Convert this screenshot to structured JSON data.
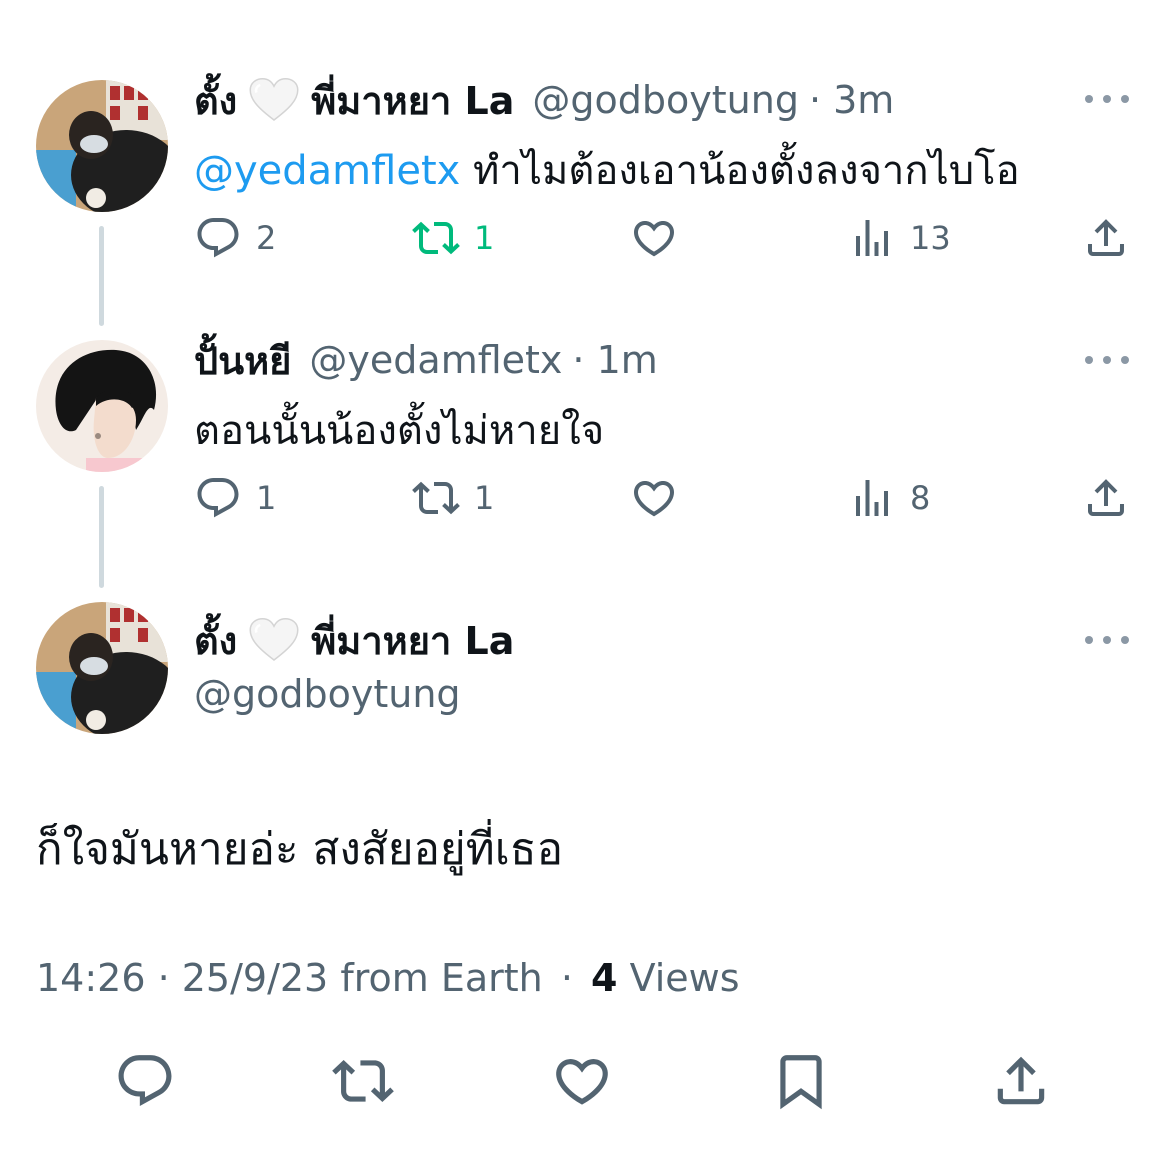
{
  "tweets": [
    {
      "name_part1": "ตั้ง",
      "name_part2": "พี่มาหยา La",
      "handle": "@godboytung",
      "time": "· 3m",
      "mention": "@yedamfletx",
      "text": "ทำไมต้องเอาน้องตั้งลงจากไบโอ",
      "replies": "2",
      "retweets": "1",
      "views": "13"
    },
    {
      "name": "ปั้นหยี",
      "handle": "@yedamfletx",
      "time": "· 1m",
      "text": "ตอนนั้นน้องตั้งไม่หายใจ",
      "replies": "1",
      "retweets": "1",
      "views": "8"
    }
  ],
  "main_tweet": {
    "name_part1": "ตั้ง",
    "name_part2": "พี่มาหยา La",
    "handle": "@godboytung",
    "text": "ก็ใจมันหายอ่ะ สงสัยอยู่ที่เธอ",
    "timestamp": "14:26 · 25/9/23 from Earth",
    "separator": "·",
    "views_count": "4",
    "views_label": "Views"
  },
  "icons": {
    "reply": "reply-icon",
    "retweet": "retweet-icon",
    "like": "heart-icon",
    "views": "views-icon",
    "share": "share-icon",
    "bookmark": "bookmark-icon",
    "more": "more-icon",
    "white_heart_emoji": "white-heart-emoji-icon"
  },
  "colors": {
    "text": "#0f1419",
    "secondary": "#536471",
    "mention": "#1d9bf0",
    "retweet_active": "#00ba7c"
  }
}
